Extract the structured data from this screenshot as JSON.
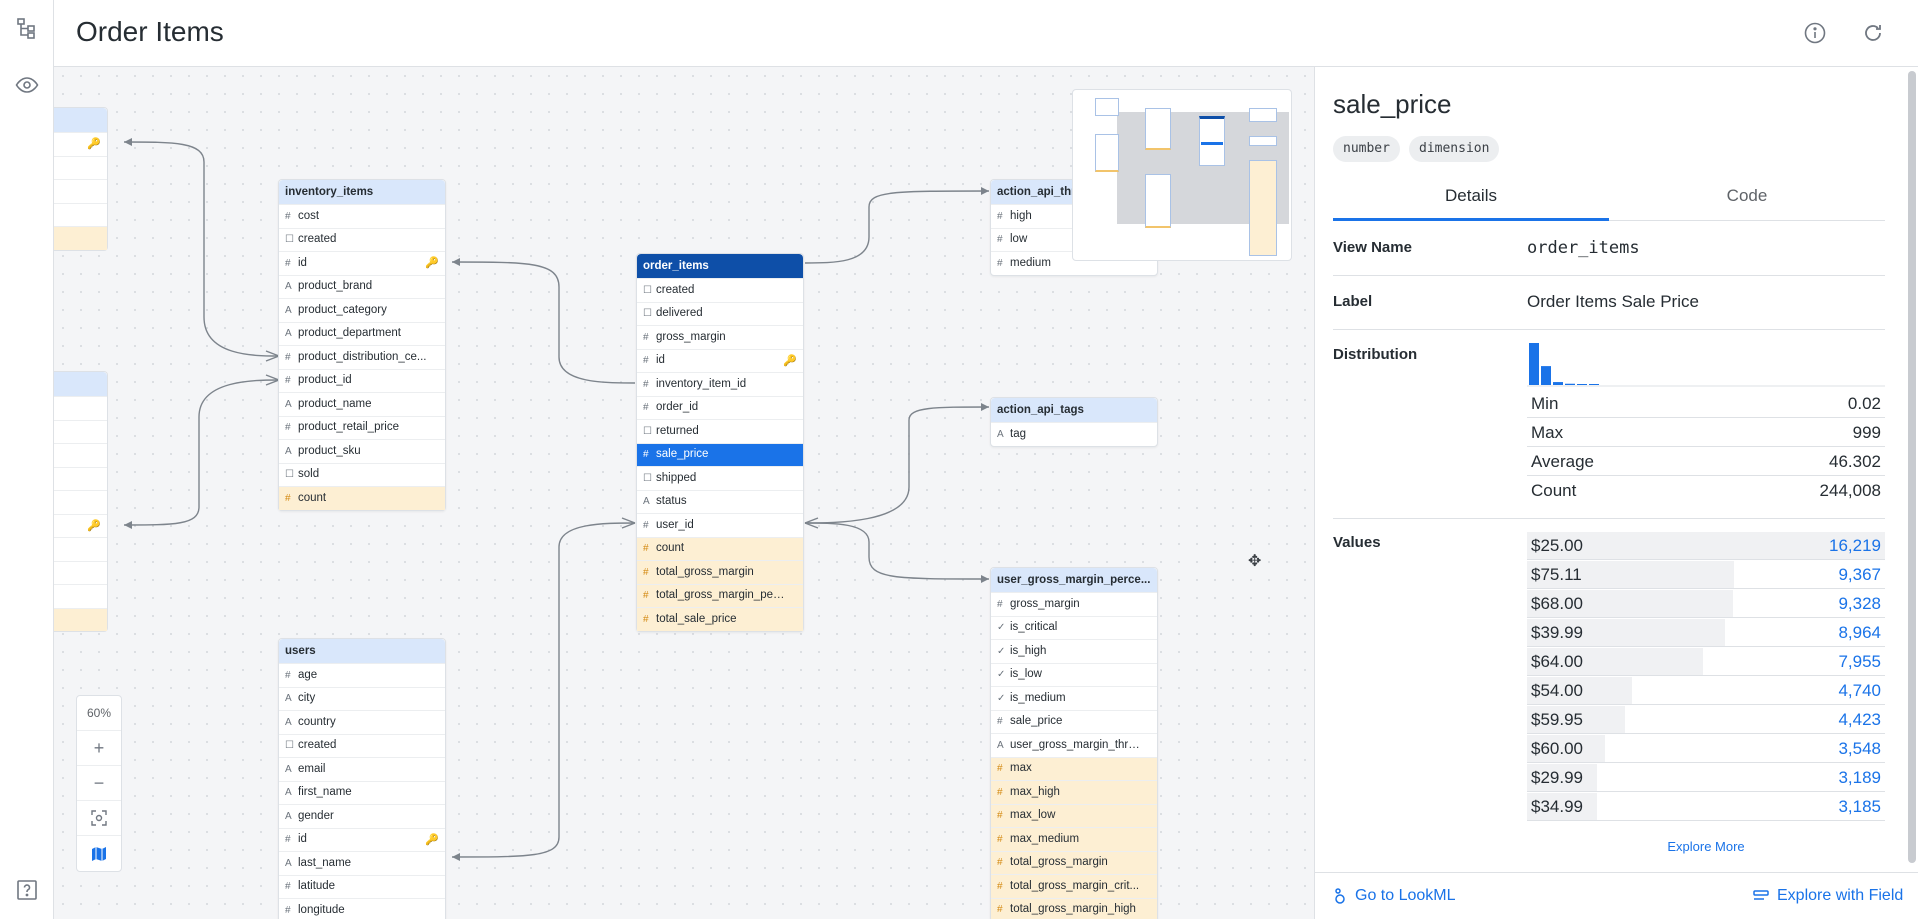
{
  "header": {
    "title": "Order Items"
  },
  "zoom": {
    "level": "60%"
  },
  "tables": {
    "inventory_items": {
      "name": "inventory_items",
      "fields": [
        {
          "icon": "#",
          "name": "cost"
        },
        {
          "icon": "☐",
          "name": "created"
        },
        {
          "icon": "#",
          "name": "id",
          "key": "🔑"
        },
        {
          "icon": "A",
          "name": "product_brand"
        },
        {
          "icon": "A",
          "name": "product_category"
        },
        {
          "icon": "A",
          "name": "product_department"
        },
        {
          "icon": "#",
          "name": "product_distribution_ce..."
        },
        {
          "icon": "#",
          "name": "product_id"
        },
        {
          "icon": "A",
          "name": "product_name"
        },
        {
          "icon": "#",
          "name": "product_retail_price"
        },
        {
          "icon": "A",
          "name": "product_sku"
        },
        {
          "icon": "☐",
          "name": "sold"
        },
        {
          "icon": "#",
          "name": "count"
        }
      ]
    },
    "order_items": {
      "name": "order_items",
      "fields": [
        {
          "icon": "☐",
          "name": "created"
        },
        {
          "icon": "☐",
          "name": "delivered"
        },
        {
          "icon": "#",
          "name": "gross_margin"
        },
        {
          "icon": "#",
          "name": "id",
          "key": "🔑"
        },
        {
          "icon": "#",
          "name": "inventory_item_id"
        },
        {
          "icon": "#",
          "name": "order_id"
        },
        {
          "icon": "☐",
          "name": "returned"
        },
        {
          "icon": "#",
          "name": "sale_price"
        },
        {
          "icon": "☐",
          "name": "shipped"
        },
        {
          "icon": "A",
          "name": "status"
        },
        {
          "icon": "#",
          "name": "user_id"
        },
        {
          "icon": "#",
          "name": "count"
        },
        {
          "icon": "#",
          "name": "total_gross_margin"
        },
        {
          "icon": "#",
          "name": "total_gross_margin_perc..."
        },
        {
          "icon": "#",
          "name": "total_sale_price"
        }
      ]
    },
    "action_api_thresholds": {
      "name": "action_api_thr...",
      "fields": [
        {
          "icon": "#",
          "name": "high"
        },
        {
          "icon": "#",
          "name": "low"
        },
        {
          "icon": "#",
          "name": "medium"
        }
      ]
    },
    "action_api_tags": {
      "name": "action_api_tags",
      "fields": [
        {
          "icon": "A",
          "name": "tag"
        }
      ]
    },
    "user_gross_margin": {
      "name": "user_gross_margin_perce...",
      "fields": [
        {
          "icon": "#",
          "name": "gross_margin"
        },
        {
          "icon": "✓",
          "name": "is_critical"
        },
        {
          "icon": "✓",
          "name": "is_high"
        },
        {
          "icon": "✓",
          "name": "is_low"
        },
        {
          "icon": "✓",
          "name": "is_medium"
        },
        {
          "icon": "#",
          "name": "sale_price"
        },
        {
          "icon": "A",
          "name": "user_gross_margin_thres..."
        },
        {
          "icon": "#",
          "name": "max"
        },
        {
          "icon": "#",
          "name": "max_high"
        },
        {
          "icon": "#",
          "name": "max_low"
        },
        {
          "icon": "#",
          "name": "max_medium"
        },
        {
          "icon": "#",
          "name": "total_gross_margin"
        },
        {
          "icon": "#",
          "name": "total_gross_margin_crit..."
        },
        {
          "icon": "#",
          "name": "total_gross_margin_high"
        }
      ]
    },
    "users": {
      "name": "users",
      "fields": [
        {
          "icon": "#",
          "name": "age"
        },
        {
          "icon": "A",
          "name": "city"
        },
        {
          "icon": "A",
          "name": "country"
        },
        {
          "icon": "☐",
          "name": "created"
        },
        {
          "icon": "A",
          "name": "email"
        },
        {
          "icon": "A",
          "name": "first_name"
        },
        {
          "icon": "A",
          "name": "gender"
        },
        {
          "icon": "#",
          "name": "id",
          "key": "🔑"
        },
        {
          "icon": "A",
          "name": "last_name"
        },
        {
          "icon": "#",
          "name": "latitude"
        },
        {
          "icon": "#",
          "name": "longitude"
        }
      ]
    },
    "ghost_key": "🔑"
  },
  "panel": {
    "title": "sale_price",
    "badges": [
      "number",
      "dimension"
    ],
    "tabs": {
      "details": "Details",
      "code": "Code"
    },
    "view_name_label": "View Name",
    "view_name": "order_items",
    "label_label": "Label",
    "label": "Order Items Sale Price",
    "distribution_label": "Distribution",
    "distribution_histogram": [
      1,
      0.45,
      0.07,
      0.03,
      0.01,
      0.005
    ],
    "stats": {
      "min_label": "Min",
      "min": "0.02",
      "max_label": "Max",
      "max": "999",
      "avg_label": "Average",
      "avg": "46.302",
      "count_label": "Count",
      "count": "244,008"
    },
    "values_label": "Values",
    "values": [
      {
        "label": "$25.00",
        "count": "16,219",
        "n": 16219
      },
      {
        "label": "$75.11",
        "count": "9,367",
        "n": 9367
      },
      {
        "label": "$68.00",
        "count": "9,328",
        "n": 9328
      },
      {
        "label": "$39.99",
        "count": "8,964",
        "n": 8964
      },
      {
        "label": "$64.00",
        "count": "7,955",
        "n": 7955
      },
      {
        "label": "$54.00",
        "count": "4,740",
        "n": 4740
      },
      {
        "label": "$59.95",
        "count": "4,423",
        "n": 4423
      },
      {
        "label": "$60.00",
        "count": "3,548",
        "n": 3548
      },
      {
        "label": "$29.99",
        "count": "3,189",
        "n": 3189
      },
      {
        "label": "$34.99",
        "count": "3,185",
        "n": 3185
      }
    ],
    "explore_more": "Explore More",
    "go_to_lookml": "Go to LookML",
    "explore_with_field": "Explore with Field"
  }
}
